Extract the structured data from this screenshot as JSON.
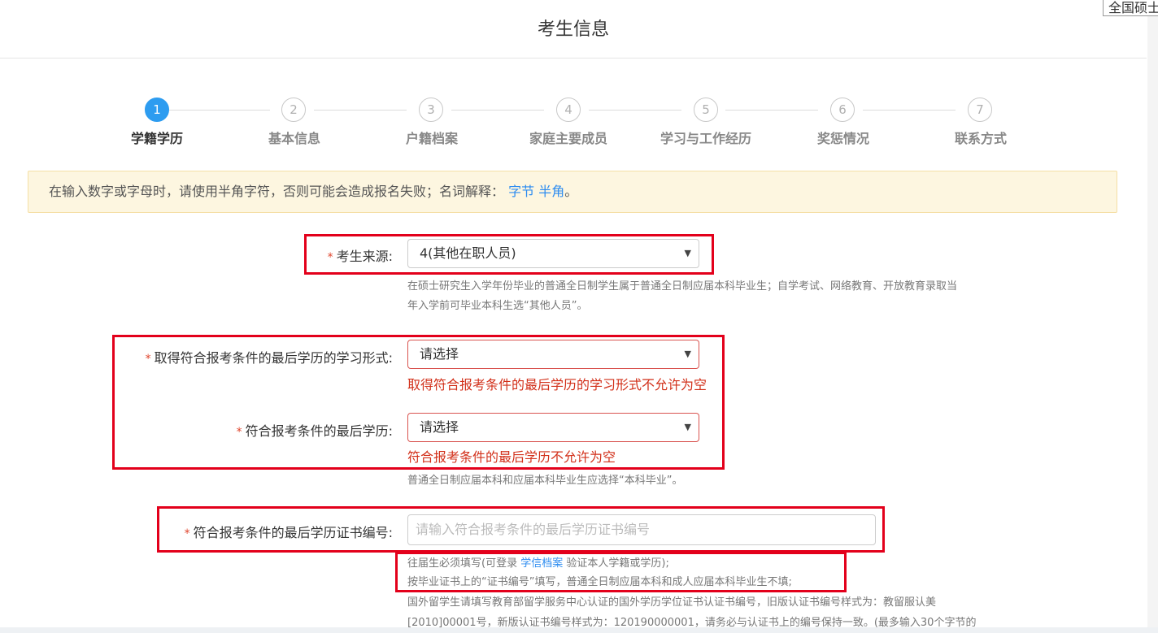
{
  "header": {
    "title": "考生信息",
    "corner_tab": "全国硕士"
  },
  "steps": [
    {
      "num": "1",
      "label": "学籍学历",
      "active": true
    },
    {
      "num": "2",
      "label": "基本信息"
    },
    {
      "num": "3",
      "label": "户籍档案"
    },
    {
      "num": "4",
      "label": "家庭主要成员"
    },
    {
      "num": "5",
      "label": "学习与工作经历"
    },
    {
      "num": "6",
      "label": "奖惩情况"
    },
    {
      "num": "7",
      "label": "联系方式"
    }
  ],
  "notice": {
    "text": "在输入数字或字母时，请使用半角字符，否则可能会造成报名失败；名词解释：",
    "link1": "字节",
    "link2": "半角",
    "end": "。"
  },
  "form": {
    "required_mark": "*",
    "source": {
      "label": "考生来源:",
      "value": "4(其他在职人员)",
      "help1": "在硕士研究生入学年份毕业的普通全日制学生属于普通全日制应届本科毕业生；自学考试、网络教育、开放教育录取当",
      "help2": "年入学前可毕业本科生选“其他人员”。"
    },
    "study_form": {
      "label": "取得符合报考条件的最后学历的学习形式:",
      "value": "请选择",
      "error": "取得符合报考条件的最后学历的学习形式不允许为空"
    },
    "last_degree": {
      "label": "符合报考条件的最后学历:",
      "value": "请选择",
      "error": "符合报考条件的最后学历不允许为空",
      "help": "普通全日制应届本科和应届本科毕业生应选择“本科毕业”。"
    },
    "cert_no": {
      "label": "符合报考条件的最后学历证书编号:",
      "placeholder": "请输入符合报考条件的最后学历证书编号",
      "help1_pre": "往届生必须填写(可登录 ",
      "help1_link": "学信档案",
      "help1_post": " 验证本人学籍或学历);",
      "help2": "按毕业证书上的“证书编号”填写，普通全日制应届本科和成人应届本科毕业生不填;",
      "help3": "国外留学生请填写教育部留学服务中心认证的国外学历学位证书认证书编号，旧版认证书编号样式为：教留服认美",
      "help4": "[2010]00001号，新版认证书编号样式为：120190000001，请务必与认证书上的编号保持一致。(最多输入30个字节的"
    }
  }
}
